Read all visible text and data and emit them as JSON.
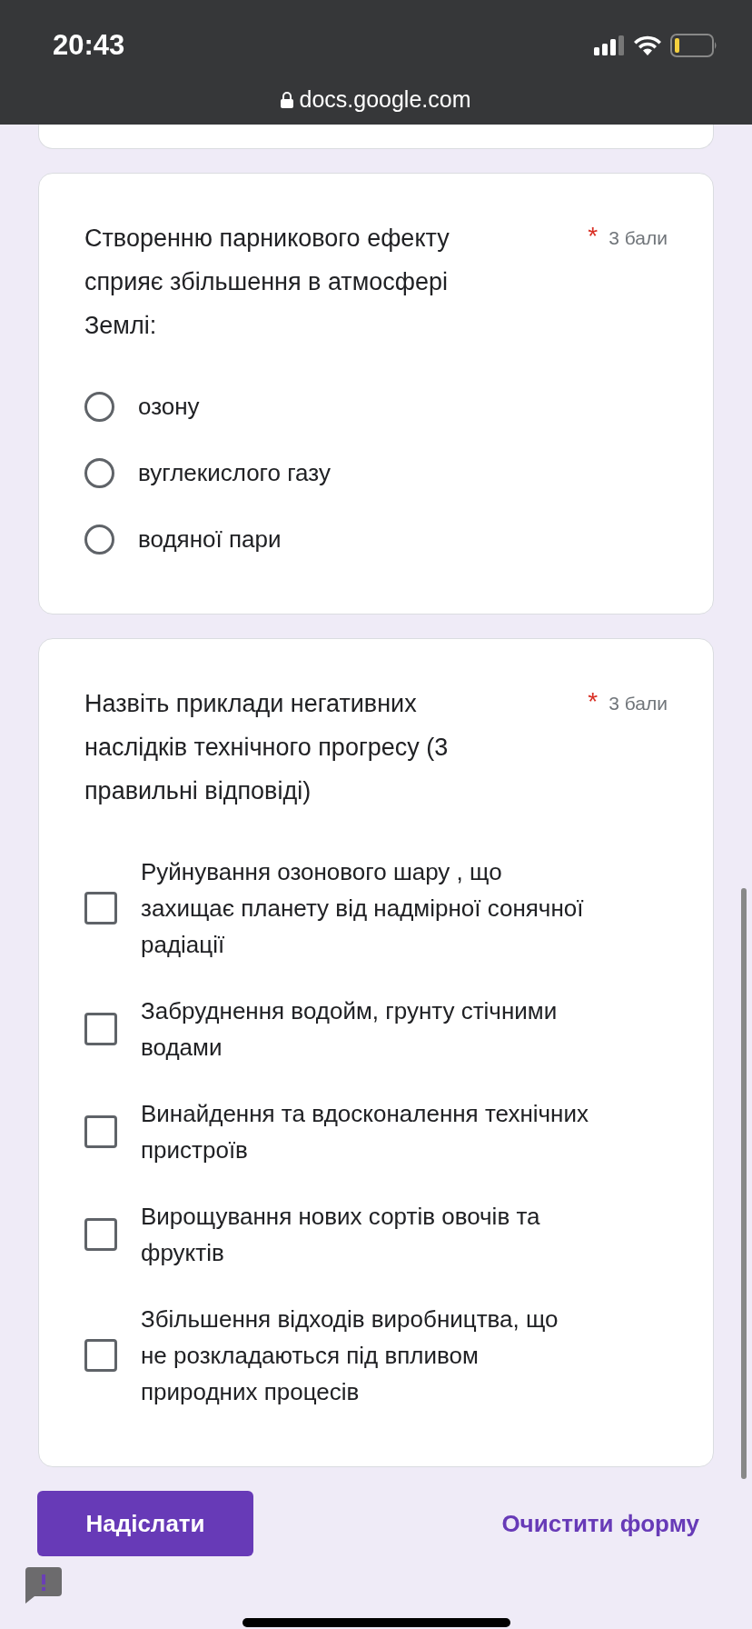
{
  "status_bar": {
    "time": "20:43"
  },
  "address_bar": {
    "url": "docs.google.com"
  },
  "questions": [
    {
      "kind": "radio",
      "title": "Створенню парникового ефекту сприяє збільшення в атмосфері Землі:",
      "required_mark": "*",
      "points": "3 бали",
      "options": [
        {
          "label": "озону",
          "selected": false
        },
        {
          "label": "вуглекислого газу",
          "selected": false
        },
        {
          "label": "водяної пари",
          "selected": false
        }
      ]
    },
    {
      "kind": "checkbox",
      "title": "Назвіть приклади негативних наслідків технічного прогресу (3 правильні відповіді)",
      "required_mark": "*",
      "points": "3 бали",
      "options": [
        {
          "label": "Руйнування озонового шару , що захищає планету від надмірної сонячної радіації",
          "checked": false
        },
        {
          "label": "Забруднення водойм, грунту стічними водами",
          "checked": false
        },
        {
          "label": "Винайдення та вдосконалення технічних пристроїв",
          "checked": false
        },
        {
          "label": "Вирощування нових сортів овочів та фруктів",
          "checked": false
        },
        {
          "label": "Збільшення відходів виробництва, що не розкладаються під впливом природних процесів",
          "checked": false
        }
      ]
    }
  ],
  "actions": {
    "submit": "Надіслати",
    "clear": "Очистити форму"
  }
}
